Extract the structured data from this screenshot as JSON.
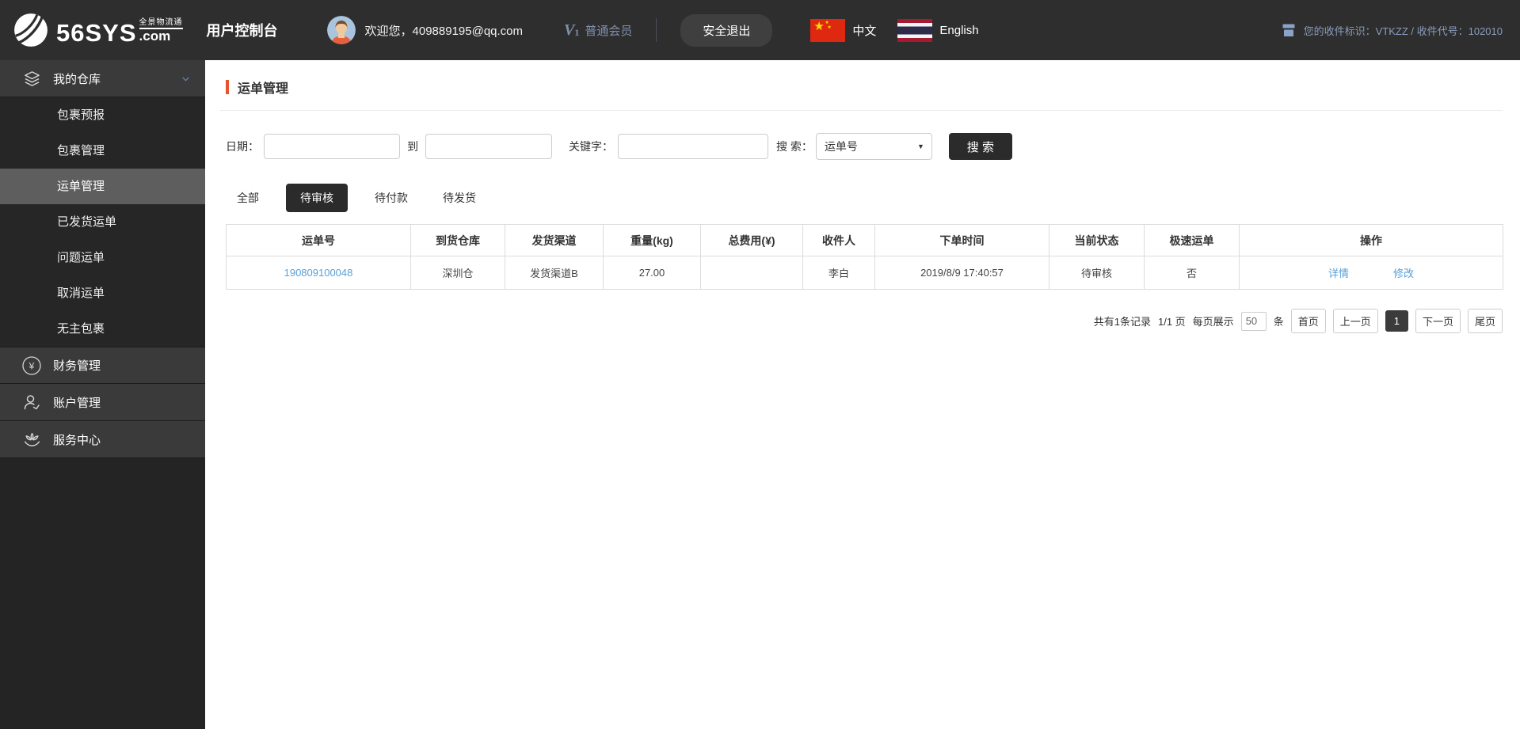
{
  "colors": {
    "accent": "#e6532d",
    "link": "#57a0da",
    "header_info": "#8b9cbc",
    "dark_button": "#2b2b2b"
  },
  "header": {
    "logo": {
      "brand": "56SYS",
      "tagline": "全景物流通",
      "domain": ".com"
    },
    "console_title": "用户控制台",
    "welcome": "欢迎您，409889195@qq.com",
    "member": {
      "v_icon": "V",
      "v_sub": "1",
      "label": "普通会员"
    },
    "logout_label": "安全退出",
    "lang_zh": "中文",
    "lang_en": "English",
    "receiver_info": "您的收件标识：VTKZZ / 收件代号：102010"
  },
  "sidebar": {
    "warehouse_label": "我的仓库",
    "submenu": [
      "包裹预报",
      "包裹管理",
      "运单管理",
      "已发货运单",
      "问题运单",
      "取消运单",
      "无主包裹"
    ],
    "finance_label": "财务管理",
    "account_label": "账户管理",
    "service_label": "服务中心"
  },
  "main": {
    "page_title": "运单管理",
    "filters": {
      "date_label": "日期：",
      "to_label": "到",
      "keyword_label": "关键字：",
      "search_label": "搜 索：",
      "search_type_selected": "运单号",
      "search_button": "搜 索"
    },
    "tabs_labels": [
      "全部",
      "待审核",
      "待付款",
      "待发货"
    ],
    "active_tab": "待审核",
    "table": {
      "headers": [
        "运单号",
        "到货仓库",
        "发货渠道",
        "重量(kg)",
        "总费用(¥)",
        "收件人",
        "下单时间",
        "当前状态",
        "极速运单",
        "操作"
      ],
      "row": {
        "waybill_no": "190809100048",
        "warehouse": "深圳仓",
        "channel": "发货渠道B",
        "weight": "27.00",
        "total_fee": "",
        "recipient": "李白",
        "order_time": "2019/8/9 17:40:57",
        "status": "待审核",
        "express": "否",
        "action_detail": "详情",
        "action_edit": "修改"
      }
    },
    "pagination": {
      "summary": "共有1条记录",
      "page_info": "1/1 页",
      "per_page_label": "每页展示",
      "per_page_value": "50",
      "unit_label": "条",
      "first": "首页",
      "prev": "上一页",
      "current": "1",
      "next": "下一页",
      "last": "尾页"
    }
  }
}
